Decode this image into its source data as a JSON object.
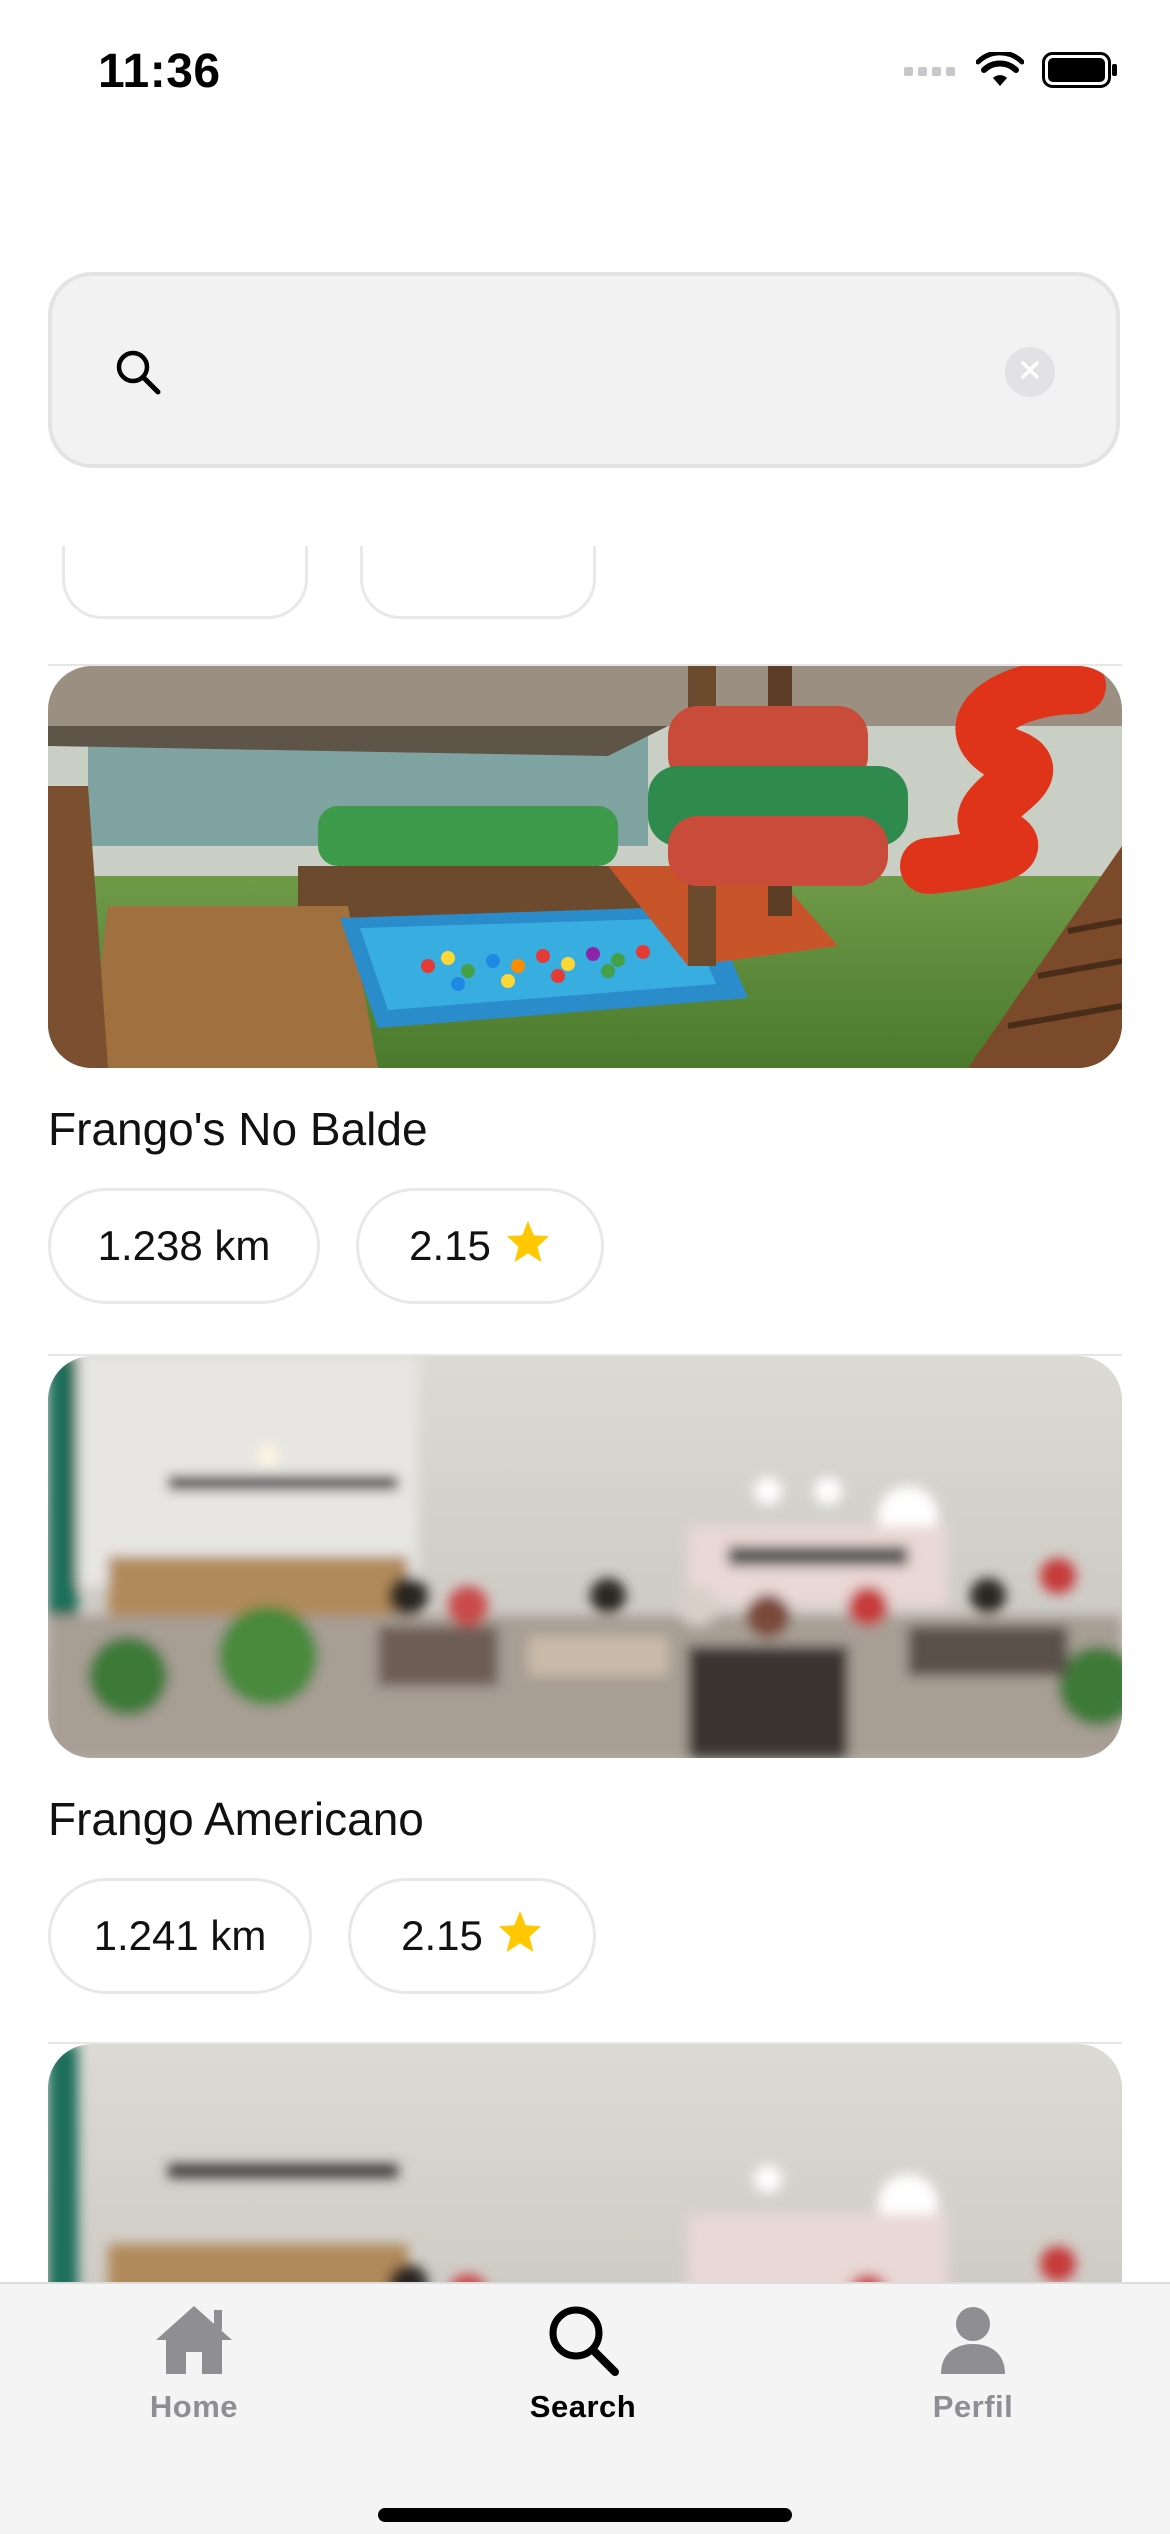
{
  "status_bar": {
    "time": "11:36"
  },
  "search": {
    "placeholder": "",
    "value": ""
  },
  "places": [
    {
      "name": "Frango's No Balde",
      "distance": "1.238 km",
      "rating": "2.15"
    },
    {
      "name": "Frango Americano",
      "distance": "1.241 km",
      "rating": "2.15"
    }
  ],
  "tab_bar": {
    "items": [
      {
        "label": "Home",
        "icon": "home-icon",
        "active": false
      },
      {
        "label": "Search",
        "icon": "search-icon",
        "active": true
      },
      {
        "label": "Perfil",
        "icon": "person-icon",
        "active": false
      }
    ]
  },
  "colors": {
    "star": "#ffc800",
    "tab_inactive": "#8e8e93",
    "tab_active": "#000000",
    "pill_border": "#e8e8ea",
    "search_bg": "#f2f2f3"
  }
}
